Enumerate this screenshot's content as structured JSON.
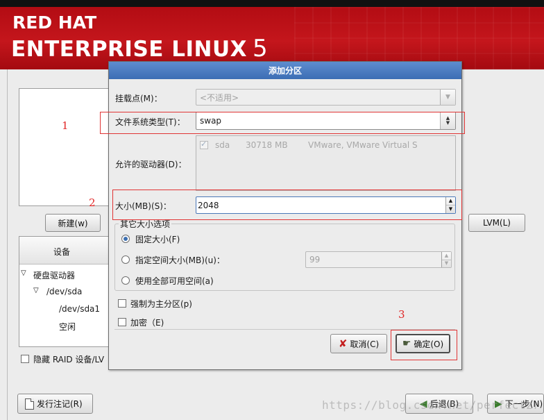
{
  "banner": {
    "line1": "RED HAT",
    "line2": "ENTERPRISE LINUX",
    "version": "5"
  },
  "background": {
    "new_button": "新建(w)",
    "lvm_button": "LVM(L)",
    "device_header": "设备",
    "tree": {
      "hard_drives": "硬盘驱动器",
      "dev_sda": "/dev/sda",
      "dev_sda1": "/dev/sda1",
      "free": "空闲"
    },
    "hide_raid": "隐藏 RAID 设备/LV",
    "release_notes": "发行注记(R)",
    "back_button": "后退(B)",
    "next_button": "下一步(N)"
  },
  "dialog": {
    "title": "添加分区",
    "mount_point_label": "挂载点(M)：",
    "mount_point_value": "<不适用>",
    "fs_type_label": "文件系统类型(T)：",
    "fs_type_value": "swap",
    "drives_label": "允许的驱动器(D)：",
    "drive_row": {
      "name": "sda",
      "size": "30718 MB",
      "model": "VMware, VMware Virtual S"
    },
    "size_label": "大小(MB)(S)：",
    "size_value": "2048",
    "other_size_group": "其它大小选项",
    "opt_fixed": "固定大小(F)",
    "opt_fill_max": "指定空间大小(MB)(u)：",
    "fill_max_value": "99",
    "opt_fill_all": "使用全部可用空间(a)",
    "force_primary": "强制为主分区(p)",
    "encrypt": "加密（E)",
    "cancel_button": "取消(C)",
    "ok_button": "确定(O)"
  },
  "annotations": {
    "n1": "1",
    "n2": "2",
    "n3": "3"
  },
  "watermark": "https://blog.csdn.net/perfectzr",
  "colors": {
    "banner_red": "#c4161c",
    "title_blue": "#3c6db4",
    "annotation_red": "#e03434"
  }
}
